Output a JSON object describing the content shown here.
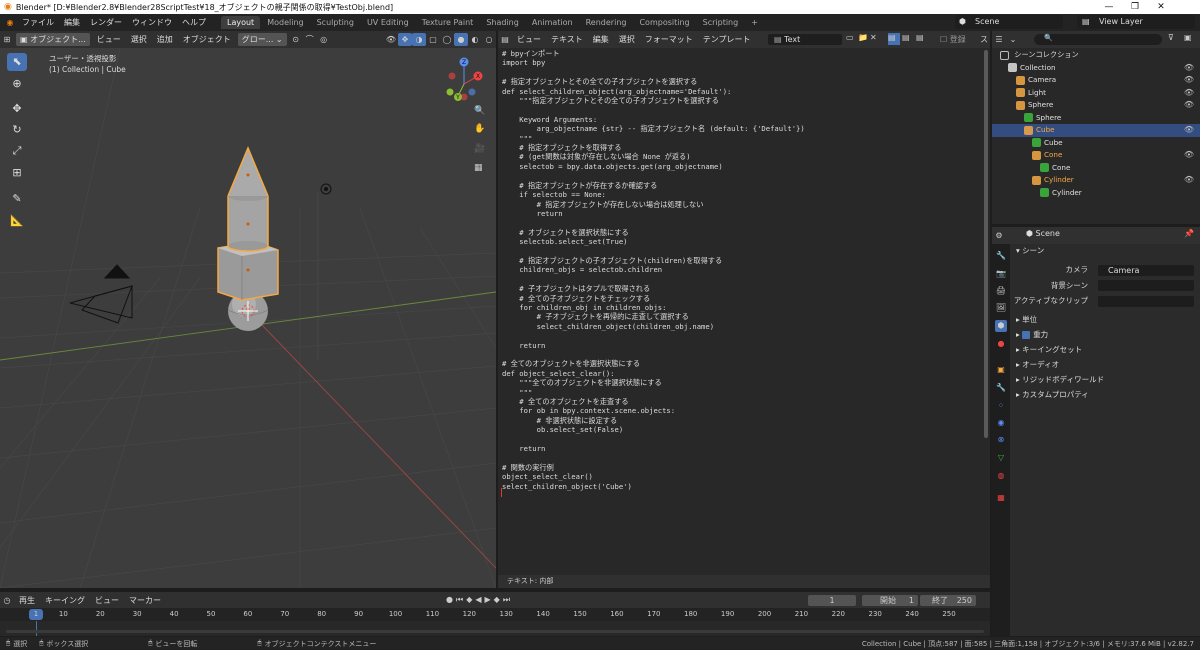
{
  "window": {
    "title": "Blender* [D:¥Blender2.8¥Blender28ScriptTest¥18_オブジェクトの親子関係の取得¥TestObj.blend]",
    "minimize": "—",
    "maximize": "❐",
    "close": "✕"
  },
  "menubar": {
    "items": [
      "ファイル",
      "編集",
      "レンダー",
      "ウィンドウ",
      "ヘルプ"
    ]
  },
  "workspaces": {
    "tabs": [
      "Layout",
      "Modeling",
      "Sculpting",
      "UV Editing",
      "Texture Paint",
      "Shading",
      "Animation",
      "Rendering",
      "Compositing",
      "Scripting"
    ],
    "active": "Layout",
    "add": "+"
  },
  "scene": {
    "name": "Scene",
    "view_layer": "View Layer"
  },
  "viewport": {
    "mode": "オブジェクト...",
    "menus": [
      "ビュー",
      "選択",
      "追加",
      "オブジェクト"
    ],
    "orientation": "グロー...",
    "view_name": "ユーザー・透視投影",
    "collection_label": "(1) Collection | Cube",
    "gizmo": {
      "x": "X",
      "y": "Y",
      "z": "Z"
    }
  },
  "text_editor": {
    "menus": [
      "ビュー",
      "テキスト",
      "編集",
      "選択",
      "フォーマット",
      "テンプレート"
    ],
    "text_name": "Text",
    "register_label": "登録",
    "footer": "テキスト: 内部",
    "code": "# bpyインポート\nimport bpy\n\n# 指定オブジェクトとその全ての子オブジェクトを選択する\ndef select_children_object(arg_objectname='Default'):\n    \"\"\"指定オブジェクトとその全ての子オブジェクトを選択する\n\n    Keyword Arguments:\n        arg_objectname {str} -- 指定オブジェクト名 (default: {'Default'})\n    \"\"\"\n    # 指定オブジェクトを取得する\n    # (get関数は対象が存在しない場合 None が返る)\n    selectob = bpy.data.objects.get(arg_objectname)\n\n    # 指定オブジェクトが存在するか確認する\n    if selectob == None:\n        # 指定オブジェクトが存在しない場合は処理しない\n        return\n\n    # オブジェクトを選択状態にする\n    selectob.select_set(True)\n\n    # 指定オブジェクトの子オブジェクト(children)を取得する\n    children_objs = selectob.children\n\n    # 子オブジェクトはタプルで取得される\n    # 全ての子オブジェクトをチェックする\n    for children_obj in children_objs:\n        # 子オブジェクトを再帰的に走査して選択する\n        select_children_object(children_obj.name)\n\n    return\n\n# 全てのオブジェクトを非選択状態にする\ndef object_select_clear():\n    \"\"\"全てのオブジェクトを非選択状態にする\n    \"\"\"\n    # 全てのオブジェクトを走査する\n    for ob in bpy.context.scene.objects:\n        # 非選択状態に設定する\n        ob.select_set(False)\n\n    return\n\n# 関数の実行例\nobject_select_clear()\nselect_children_object('Cube')"
  },
  "outliner": {
    "root": "シーンコレクション",
    "items": [
      {
        "label": "Collection",
        "indent": 1,
        "color": "#e0e0e0",
        "icon": "collection-icon",
        "eye": true
      },
      {
        "label": "Camera",
        "indent": 2,
        "color": "#e0e0e0",
        "icon": "camera-icon",
        "eye": true
      },
      {
        "label": "Light",
        "indent": 2,
        "color": "#e0e0e0",
        "icon": "light-icon",
        "eye": true
      },
      {
        "label": "Sphere",
        "indent": 2,
        "color": "#e0e0e0",
        "icon": "mesh-icon",
        "eye": true
      },
      {
        "label": "Sphere",
        "indent": 3,
        "color": "#e0e0e0",
        "icon": "mesh-data-icon",
        "eye": false
      },
      {
        "label": "Cube",
        "indent": 3,
        "color": "#f5a843",
        "icon": "mesh-icon",
        "eye": true
      },
      {
        "label": "Cube",
        "indent": 4,
        "color": "#e0e0e0",
        "icon": "mesh-data-icon",
        "eye": false
      },
      {
        "label": "Cone",
        "indent": 4,
        "color": "#f5a843",
        "icon": "mesh-icon",
        "eye": true
      },
      {
        "label": "Cone",
        "indent": 5,
        "color": "#e0e0e0",
        "icon": "mesh-data-icon",
        "eye": false
      },
      {
        "label": "Cylinder",
        "indent": 4,
        "color": "#f5a843",
        "icon": "mesh-icon",
        "eye": true
      },
      {
        "label": "Cylinder",
        "indent": 5,
        "color": "#e0e0e0",
        "icon": "mesh-data-icon",
        "eye": false
      }
    ]
  },
  "properties": {
    "context": "Scene",
    "section": "シーン",
    "fields": [
      {
        "label": "カメラ",
        "value": "Camera"
      },
      {
        "label": "背景シーン",
        "value": ""
      },
      {
        "label": "アクティブなクリップ",
        "value": ""
      }
    ],
    "panels": [
      "単位",
      "重力",
      "キーイングセット",
      "オーディオ",
      "リジッドボディワールド",
      "カスタムプロパティ"
    ]
  },
  "timeline": {
    "menus": [
      "再生",
      "キーイング",
      "ビュー",
      "マーカー"
    ],
    "current_frame": "1",
    "start_label": "開始",
    "start": "1",
    "end_label": "終了",
    "end": "250",
    "ticks": [
      "1",
      "10",
      "20",
      "30",
      "40",
      "50",
      "60",
      "70",
      "80",
      "90",
      "100",
      "110",
      "120",
      "130",
      "140",
      "150",
      "160",
      "170",
      "180",
      "190",
      "200",
      "210",
      "220",
      "230",
      "240",
      "250"
    ]
  },
  "statusbar": {
    "select": "選択",
    "box_select": "ボックス選択",
    "rotate_view": "ビューを回転",
    "context_menu": "オブジェクトコンテクストメニュー",
    "info": "Collection | Cube | 頂点:587 | 面:585 | 三角面:1,158 | オブジェクト:3/6 | メモリ:37.6 MiB | v2.82.7"
  },
  "colors": {
    "accent": "#4772b3",
    "selected": "#f5a843",
    "bg": "#1d1d1d"
  }
}
